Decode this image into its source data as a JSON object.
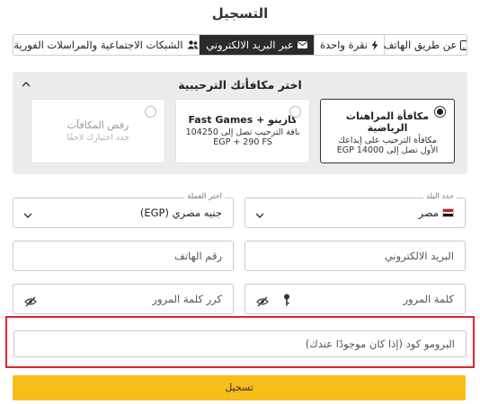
{
  "page_title": "التسجيل",
  "tabs": [
    {
      "label": "عن طريق الهاتف",
      "icon": "phone-icon",
      "active": false
    },
    {
      "label": "نقرة واحدة",
      "icon": "lightning-icon",
      "active": false
    },
    {
      "label": "عبر البريد الالكتروني",
      "icon": "envelope-icon",
      "active": true
    },
    {
      "label": "الشبكات الاجتماعية والمراسلات الفورية",
      "icon": "users-icon",
      "active": false
    }
  ],
  "bonus": {
    "heading": "اختر مكافأتك الترحيبية",
    "options": [
      {
        "title": "مكافأة المراهنات الرياضية",
        "desc": "مكافأة الترحيب على إيداعك الأول تصل إلى 14000 EGP",
        "selected": true
      },
      {
        "title": "كازينو + Fast Games",
        "desc": "باقة الترحيب تصل إلى 104250 EGP + 290 FS",
        "selected": false
      },
      {
        "title": "رفض المكافآت",
        "desc": "حدد اختيارك لاحقًا",
        "selected": false,
        "disabled": true
      }
    ]
  },
  "form": {
    "country_label": "حدد البلد",
    "country_value": "مصر",
    "currency_label": "اختر العملة",
    "currency_value": "جنيه مصري (EGP)",
    "email_placeholder": "البريد الالكتروني",
    "phone_placeholder": "رقم الهاتف",
    "password_placeholder": "كلمة المرور",
    "confirm_password_placeholder": "كرر كلمة المرور",
    "promo_placeholder": "البرومو كود (إذا كان موجودًا عندك)"
  },
  "submit_label": "تسجيل",
  "colors": {
    "accent": "#f8bd19",
    "active_tab": "#2b2b2b",
    "highlight_border": "#e0242b"
  }
}
